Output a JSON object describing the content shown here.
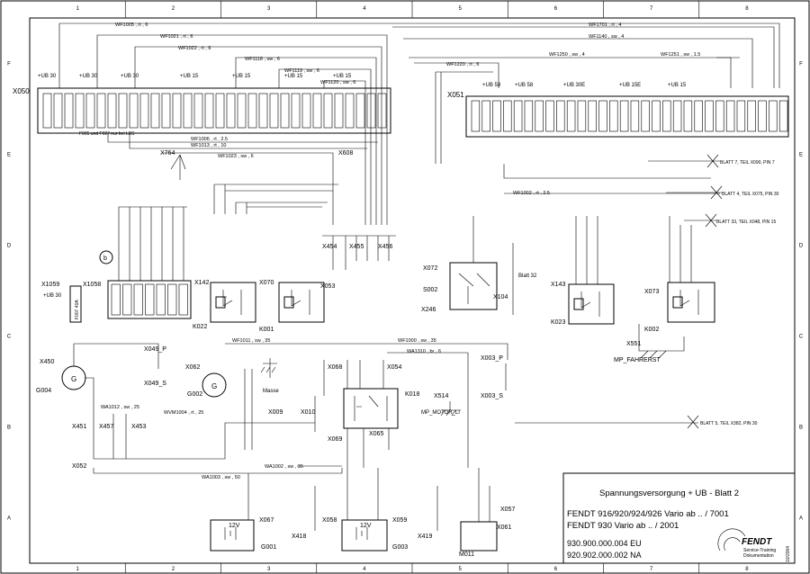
{
  "grid": {
    "columns": [
      "1",
      "2",
      "3",
      "4",
      "5",
      "6",
      "7",
      "8"
    ],
    "rows": [
      "F",
      "E",
      "D",
      "C",
      "B",
      "A"
    ]
  },
  "connectors": {
    "x050": "X050",
    "x051": "X051",
    "x764": "X764",
    "x608": "X608",
    "x1059": "X1059",
    "x1058": "X1058",
    "x142": "X142",
    "x070": "X070",
    "x053": "X053",
    "x454": "X454",
    "x455": "X455",
    "x456": "X456",
    "x072": "X072",
    "s002": "S002",
    "x246": "X246",
    "x104": "X104",
    "x143": "X143",
    "x073": "X073",
    "x551": "X551",
    "x049p": "X049_P",
    "x049s": "X049_S",
    "x062": "X062",
    "x068": "X068",
    "x054": "X054",
    "x003p": "X003_P",
    "x003s": "X003_S",
    "x514": "X514",
    "x009": "X009",
    "x010": "X010",
    "x069": "X069",
    "x065": "X065",
    "x451": "X451",
    "x457": "X457",
    "x453": "X453",
    "x052": "X052",
    "x067": "X067",
    "x058": "X058",
    "x059": "X059",
    "x418": "X418",
    "x419": "X419",
    "x057": "X057",
    "x061": "X061"
  },
  "components": {
    "k022": "K022",
    "k001": "K001",
    "k023": "K023",
    "k002": "K002",
    "k018": "K018",
    "g004": "G004",
    "g002": "G002",
    "g001": "G001",
    "g003": "G003",
    "m011": "M011",
    "x450": "X450"
  },
  "labels": {
    "ub30": "+UB 30",
    "ub15": "+UB 15",
    "ub58": "+UB 58",
    "ub30e": "+UB 30E",
    "ub15e": "+UB 15E",
    "lbs_note": "F005 und F027 nur bei LBS",
    "blatt32": "Blatt 32",
    "masse": "Masse",
    "mp_fahrerst": "MP_FAHRERST",
    "mp_motor": "MP_MOTOR_LI",
    "ref_b": "b",
    "g_label": "G",
    "volt12": "12V",
    "x1059_ub": "+UB 30",
    "f001_40a": "F007 40A"
  },
  "offsheet": [
    "BLATT 7, TEIL X090, PIN 7",
    "BLATT 4, TEIL X075, PIN 30",
    "BLATT 33, TEIL X048, PIN 15",
    "BLATT 5, TEIL X382, PIN 30"
  ],
  "wires": {
    "wf1005": "WF1005 , rt , 6",
    "wf1021": "WF1021 , rt , 6",
    "wf1022": "WF1022 , rt , 6",
    "wf1118": "WF1118 , sw , 6",
    "wf1119": "WF1119 , sw , 6",
    "wf1120": "WF1120 , sw , 6",
    "wf1701": "WF1701 , rt , 4",
    "wf1140": "WF1140 , sw , 4",
    "wf1250": "WF1250 , sw , 4",
    "wf1251": "WF1251 , sw , 1.5",
    "wf1220": "WF1220 , rt , 6",
    "wf1006": "WF1006 , rt , 2.5",
    "wf1013": "WF1013 , rt , 10",
    "wf1023": "WF1023 , sw , 6",
    "wf1002": "WF1002 , rt , 2.5",
    "wf1011": "WF1011 , sw , 35",
    "wf1000": "WF1000 , sw , 35",
    "wa1310": "WA1310 , br , 6",
    "wa1002": "WA1002 , sw , 35",
    "wa1003": "WA1003 , sw , 50",
    "wa1012": "WA1012 , sw , 25",
    "wvm1004": "WVM1004 , rt , 25"
  },
  "title_block": {
    "title": "Spannungsversorgung + UB - Blatt 2",
    "model_line1": "FENDT 916/920/924/926 Vario ab .. / 7001",
    "model_line2": "FENDT 930 Vario ab .. / 2001",
    "doc_eu": "930.900.000.004 EU",
    "doc_na": "920.902.000.002 NA",
    "brand": "FENDT",
    "dept1": "Service-Training",
    "dept2": "Dokumentation",
    "date": "10/2004"
  },
  "colors": {
    "line": "#000000",
    "paper": "#ffffff"
  }
}
